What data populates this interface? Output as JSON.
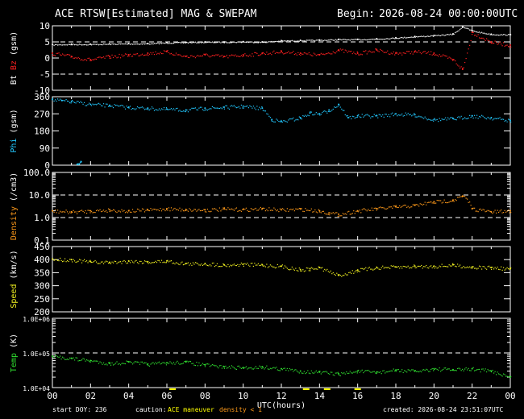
{
  "header": {
    "title": "ACE RTSW[Estimated] MAG & SWEPAM",
    "begin_label": "Begin:",
    "begin_time": "2026-08-24 00:00:00UTC"
  },
  "footer": {
    "start_doy": "start DOY: 236",
    "caution_label": "caution:",
    "maneuver_label": "ACE maneuver",
    "density_note": "density < 1",
    "created": "created: 2026-08-24 23:51:07UTC"
  },
  "colors": {
    "background": "#000000",
    "axis": "#ffffff",
    "bt": "#ffffff",
    "bz": "#ff2020",
    "phi": "#22c8ff",
    "density": "#ff9a1a",
    "speed": "#f0f020",
    "temp": "#30e030",
    "maneuver": "#ffff00",
    "density_note": "#ff9a1a"
  },
  "chart_data": [
    {
      "type": "scatter",
      "panel": "mag-bt-bz",
      "ylabel_parts": [
        {
          "text": "Bt",
          "color": "#ffffff"
        },
        {
          "text": "Bz",
          "color": "#ff2020"
        },
        {
          "text": "(gsm)",
          "color": "#ffffff"
        }
      ],
      "ylim": [
        -10,
        10
      ],
      "yticks": [
        -10,
        -5,
        0,
        5,
        10
      ],
      "ytick_labels": [
        "-10",
        "-5",
        "0",
        "5",
        "10"
      ],
      "reference_lines": [
        -5,
        5
      ],
      "series": [
        {
          "name": "Bt",
          "color": "#ffffff",
          "x": [
            0,
            1,
            2,
            3,
            4,
            5,
            6,
            7,
            8,
            9,
            10,
            11,
            12,
            13,
            14,
            15,
            16,
            17,
            18,
            19,
            20,
            21,
            21.5,
            22,
            23,
            24
          ],
          "y": [
            4.2,
            4.3,
            4.3,
            4.4,
            4.5,
            4.5,
            4.8,
            4.9,
            5.0,
            5.0,
            5.1,
            5.0,
            5.4,
            5.5,
            5.6,
            5.8,
            5.8,
            6.0,
            6.3,
            6.7,
            7.0,
            7.5,
            9.8,
            8.5,
            7.4,
            7.3
          ]
        },
        {
          "name": "Bz",
          "color": "#ff2020",
          "x": [
            0,
            1,
            2,
            3,
            4,
            5,
            6,
            7,
            8,
            9,
            10,
            11,
            12,
            13,
            14,
            15,
            16,
            17,
            18,
            19,
            20,
            21,
            21.5,
            22,
            23,
            24
          ],
          "y": [
            1.5,
            0.5,
            -0.5,
            0.5,
            1.0,
            1.5,
            2.0,
            0.5,
            1.0,
            0.5,
            1.0,
            1.5,
            2.0,
            1.5,
            1.0,
            2.5,
            1.5,
            2.5,
            1.5,
            2.0,
            1.5,
            -0.5,
            -3.5,
            8.0,
            5.0,
            4.0
          ]
        }
      ]
    },
    {
      "type": "scatter",
      "panel": "phi",
      "ylabel_parts": [
        {
          "text": "Phi",
          "color": "#22c8ff"
        },
        {
          "text": "(gsm)",
          "color": "#ffffff"
        }
      ],
      "ylim": [
        0,
        360
      ],
      "yticks": [
        0,
        90,
        180,
        270,
        360
      ],
      "ytick_labels": [
        "0",
        "90",
        "180",
        "270",
        "360"
      ],
      "series": [
        {
          "name": "Phi",
          "color": "#22c8ff",
          "x": [
            0,
            0.5,
            1,
            2,
            3,
            4,
            5,
            6,
            7,
            8,
            9,
            10,
            11,
            11.5,
            12,
            13,
            13.5,
            14,
            14.5,
            15,
            15.5,
            16,
            17,
            18,
            19,
            20,
            21,
            22,
            23,
            24
          ],
          "y": [
            345,
            340,
            335,
            320,
            315,
            305,
            300,
            295,
            290,
            300,
            305,
            310,
            300,
            240,
            230,
            250,
            275,
            270,
            290,
            320,
            250,
            260,
            260,
            270,
            265,
            240,
            245,
            260,
            250,
            235
          ]
        },
        {
          "name": "Phi",
          "color": "#22c8ff",
          "x": [
            1.3,
            1.5
          ],
          "y": [
            5,
            18
          ]
        }
      ]
    },
    {
      "type": "scatter",
      "panel": "density",
      "log": true,
      "ylabel_parts": [
        {
          "text": "Density",
          "color": "#ff9a1a"
        },
        {
          "text": "(/cm3)",
          "color": "#ffffff"
        }
      ],
      "ylim": [
        0.1,
        100
      ],
      "yticks": [
        0.1,
        1,
        10,
        100
      ],
      "ytick_labels": [
        "0.1",
        "1.0",
        "10.0",
        "100.0"
      ],
      "reference_lines": [
        1,
        10
      ],
      "series": [
        {
          "name": "Density",
          "color": "#ff9a1a",
          "x": [
            0,
            1,
            2,
            3,
            4,
            5,
            6,
            7,
            8,
            9,
            10,
            11,
            12,
            13,
            14,
            14.5,
            15,
            16,
            17,
            18,
            19,
            20,
            21,
            21.5,
            22,
            23,
            24
          ],
          "y": [
            2.0,
            1.8,
            2.0,
            2.2,
            2.0,
            2.2,
            2.5,
            2.3,
            2.2,
            2.4,
            2.3,
            2.5,
            2.2,
            2.4,
            2.0,
            1.6,
            1.4,
            2.0,
            2.5,
            3.0,
            3.5,
            5.0,
            6.0,
            9.0,
            2.5,
            1.8,
            2.0
          ]
        }
      ]
    },
    {
      "type": "scatter",
      "panel": "speed",
      "ylabel_parts": [
        {
          "text": "Speed",
          "color": "#f0f020"
        },
        {
          "text": "(km/s)",
          "color": "#ffffff"
        }
      ],
      "ylim": [
        200,
        450
      ],
      "yticks": [
        200,
        250,
        300,
        350,
        400,
        450
      ],
      "ytick_labels": [
        "200",
        "250",
        "300",
        "350",
        "400",
        "450"
      ],
      "series": [
        {
          "name": "Speed",
          "color": "#f0f020",
          "x": [
            0,
            1,
            2,
            3,
            4,
            5,
            6,
            7,
            8,
            9,
            10,
            11,
            12,
            13,
            13.5,
            14,
            15,
            16,
            17,
            18,
            19,
            20,
            21,
            22,
            23,
            24
          ],
          "y": [
            402,
            400,
            392,
            390,
            395,
            392,
            395,
            385,
            385,
            380,
            383,
            380,
            375,
            362,
            365,
            370,
            340,
            360,
            370,
            372,
            375,
            375,
            380,
            372,
            370,
            365
          ]
        }
      ]
    },
    {
      "type": "scatter",
      "panel": "temp",
      "log": true,
      "ylabel_parts": [
        {
          "text": "Temp",
          "color": "#30e030"
        },
        {
          "text": "(K)",
          "color": "#ffffff"
        }
      ],
      "ylim": [
        10000,
        1000000
      ],
      "yticks": [
        10000,
        100000,
        1000000
      ],
      "ytick_labels": [
        "1.0E+04",
        "1.0E+05",
        "1.0E+06"
      ],
      "reference_lines": [
        100000
      ],
      "series": [
        {
          "name": "Temp",
          "color": "#30e030",
          "x": [
            0,
            1,
            2,
            3,
            4,
            5,
            6,
            7,
            8,
            9,
            10,
            11,
            12,
            13,
            14,
            15,
            16,
            17,
            18,
            19,
            20,
            21,
            22,
            23,
            24
          ],
          "y": [
            80000,
            70000,
            60000,
            50000,
            55000,
            48000,
            52000,
            55000,
            45000,
            40000,
            38000,
            40000,
            35000,
            30000,
            28000,
            25000,
            30000,
            28000,
            32000,
            30000,
            35000,
            33000,
            35000,
            30000,
            20000
          ]
        }
      ],
      "xlabel": "UTC(hours)",
      "xlim": [
        0,
        24
      ],
      "xticks": [
        0,
        2,
        4,
        6,
        8,
        10,
        12,
        14,
        16,
        18,
        20,
        22,
        24
      ],
      "xtick_labels": [
        "00",
        "02",
        "04",
        "06",
        "08",
        "10",
        "12",
        "14",
        "16",
        "18",
        "20",
        "22",
        "00"
      ],
      "maneuver_markers_x": [
        6.3,
        13.3,
        14.4,
        16.0
      ]
    }
  ]
}
